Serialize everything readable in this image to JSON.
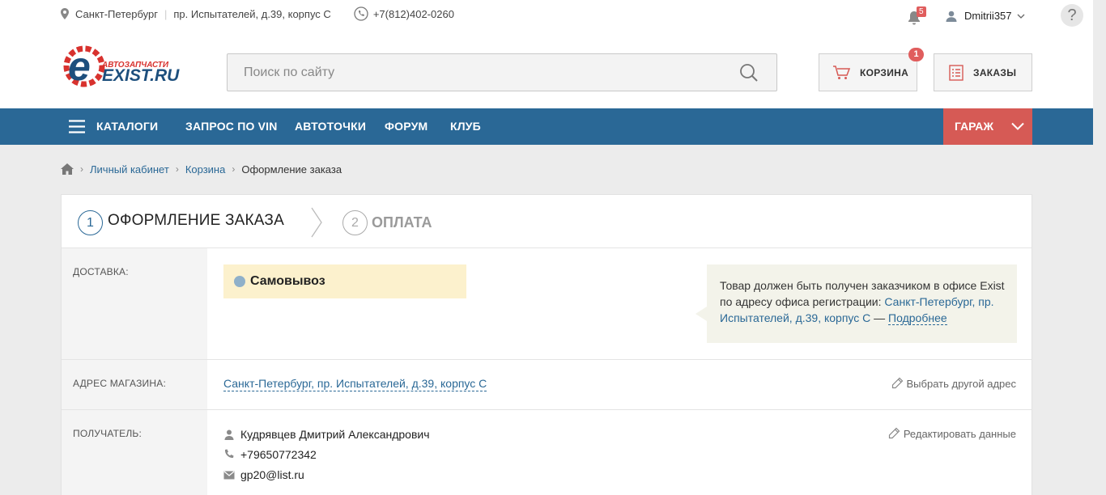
{
  "topbar": {
    "city": "Санкт-Петербург",
    "address": "пр. Испытателей, д.39, корпус С",
    "phone": "+7(812)402-0260",
    "notifications_count": "5",
    "username": "Dmitrii357",
    "help": "?"
  },
  "logo": {
    "tagline": "АВТОЗАПЧАСТИ",
    "name": "EXIST.RU",
    "accent_color": "#d8322e"
  },
  "search": {
    "placeholder": "Поиск по сайту"
  },
  "header_buttons": {
    "cart_label": "КОРЗИНА",
    "cart_count": "1",
    "orders_label": "ЗАКАЗЫ"
  },
  "nav": {
    "items": [
      "КАТАЛОГИ",
      "ЗАПРОС ПО VIN",
      "АВТОТОЧКИ",
      "ФОРУМ",
      "КЛУБ"
    ],
    "garage_label": "ГАРАЖ",
    "bg_color": "#2a6896",
    "garage_color": "#d65a55"
  },
  "breadcrumb": {
    "items": [
      "Личный кабинет",
      "Корзина"
    ],
    "current": "Оформление заказа"
  },
  "steps": [
    {
      "num": "1",
      "label": "ОФОРМЛЕНИЕ ЗАКАЗА"
    },
    {
      "num": "2",
      "label": "ОПЛАТА"
    }
  ],
  "delivery": {
    "label": "ДОСТАВКА:",
    "option": "Самовывоз",
    "info_text": "Товар должен быть получен заказчиком в офисе Exist по адресу офиса регистрации:",
    "info_address_line1": "Санкт-Петербург, пр.",
    "info_address_line2": "Испытателей, д.39, корпус С",
    "info_dash": "—",
    "info_more": "Подробнее"
  },
  "store_address": {
    "label": "АДРЕС МАГАЗИНА:",
    "value": "Санкт-Петербург, пр. Испытателей, д.39, корпус С",
    "action": "Выбрать другой адрес"
  },
  "recipient": {
    "label": "ПОЛУЧАТЕЛЬ:",
    "name": "Кудрявцев Дмитрий Александрович",
    "phone": "+79650772342",
    "email": "gp20@list.ru",
    "action": "Редактировать данные"
  }
}
